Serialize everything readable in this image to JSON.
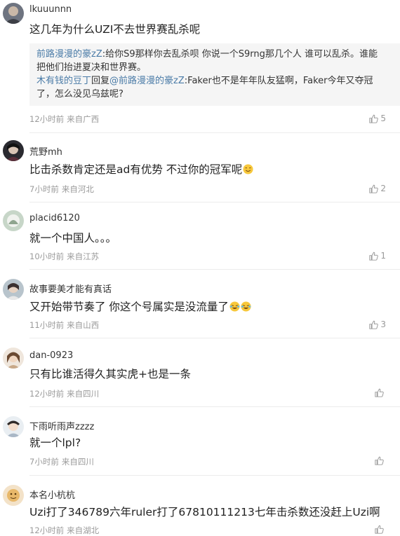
{
  "comments": [
    {
      "username": "lkuuunnn",
      "text": "这几年为什么UZI不去世界赛乱杀呢",
      "time": "12小时前",
      "location": "来自广西",
      "likes": "5",
      "replies": [
        {
          "name": "前路漫漫的豪zZ",
          "sep": ":",
          "text1": "给你S9那样你去乱杀呗 你说一个S9rng那几个人 谁可以乱杀。谁能",
          "text2": "把他们抬进夏决和世界赛。"
        },
        {
          "name": "木有钱的豆丁",
          "mid": "回复",
          "target": "@前路漫漫的豪zZ",
          "sep": ":",
          "text1": "Faker也不是年年队友猛啊，Faker今年又夺冠",
          "text2": "了，怎么没见乌兹呢?"
        }
      ]
    },
    {
      "username": "荒野mh",
      "text": "比击杀数肯定还是ad有优势 不过你的冠军呢",
      "emoji": "smile-emoji",
      "time": "7小时前",
      "location": "来自河北",
      "likes": "2"
    },
    {
      "username": "placid6120",
      "text": "就一个中国人。。。",
      "time": "10小时前",
      "location": "来自江苏",
      "likes": "1"
    },
    {
      "username": "故事要美才能有真话",
      "text": "又开始带节奏了 你这个号属实是没流量了",
      "emoji": "laugh-cry-emoji",
      "time": "11小时前",
      "location": "来自山西",
      "likes": "3"
    },
    {
      "username": "dan-0923",
      "text": "只有比谁活得久其实虎+也是一条",
      "time": "12小时前",
      "location": "来自四川",
      "likes": ""
    },
    {
      "username": "下雨听雨声zzzz",
      "text": "就一个lpl?",
      "time": "7小时前",
      "location": "来自四川",
      "likes": ""
    },
    {
      "username": "本名小杭杭",
      "text": "Uzi打了346789六年ruler打了67810111213七年击杀数还没赶上Uzi啊",
      "time": "12小时前",
      "location": "来自湖北",
      "likes": ""
    }
  ],
  "colors": {
    "link": "#4a7ba7",
    "meta": "#9a9a9a",
    "reply_bg": "#f5f5f5"
  }
}
